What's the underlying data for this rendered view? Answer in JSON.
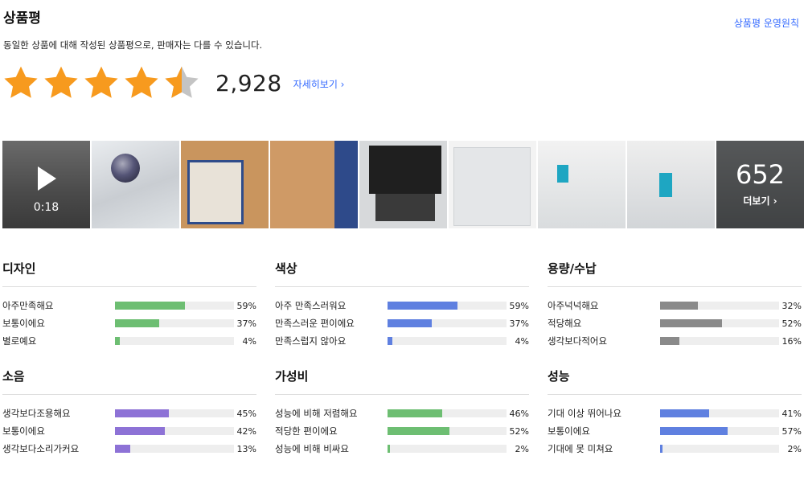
{
  "header": {
    "title": "상품평",
    "policy_link": "상품평 운영원칙",
    "subtitle": "동일한 상품에 대해 작성된 상품평으로, 판매자는 다를 수 있습니다."
  },
  "rating": {
    "stars": 4.5,
    "review_count": "2,928",
    "detail_link": "자세히보기 ›"
  },
  "gallery": {
    "video_duration": "0:18",
    "more_count": "652",
    "more_label": "더보기 ›",
    "thumbnails": [
      "video",
      "photo",
      "photo",
      "photo",
      "photo",
      "photo",
      "photo",
      "photo",
      "more"
    ]
  },
  "colors": {
    "star": "#f79a1e",
    "star_empty": "#c4c4c4",
    "green": "#6dbe72",
    "blue": "#5f80e0",
    "gray": "#8a8a8a",
    "purple": "#8d72d6",
    "link": "#346aff"
  },
  "surveys": [
    {
      "title": "디자인",
      "color": "#6dbe72",
      "rows": [
        {
          "label": "아주만족해요",
          "value": 59,
          "pct": "59%"
        },
        {
          "label": "보통이에요",
          "value": 37,
          "pct": "37%"
        },
        {
          "label": "별로예요",
          "value": 4,
          "pct": "4%"
        }
      ]
    },
    {
      "title": "색상",
      "color": "#5f80e0",
      "rows": [
        {
          "label": "아주 만족스러워요",
          "value": 59,
          "pct": "59%"
        },
        {
          "label": "만족스러운 편이에요",
          "value": 37,
          "pct": "37%"
        },
        {
          "label": "만족스럽지 않아요",
          "value": 4,
          "pct": "4%"
        }
      ]
    },
    {
      "title": "용량/수납",
      "color": "#8a8a8a",
      "rows": [
        {
          "label": "아주넉넉해요",
          "value": 32,
          "pct": "32%"
        },
        {
          "label": "적당해요",
          "value": 52,
          "pct": "52%"
        },
        {
          "label": "생각보다적어요",
          "value": 16,
          "pct": "16%"
        }
      ]
    },
    {
      "title": "소음",
      "color": "#8d72d6",
      "rows": [
        {
          "label": "생각보다조용해요",
          "value": 45,
          "pct": "45%"
        },
        {
          "label": "보통이에요",
          "value": 42,
          "pct": "42%"
        },
        {
          "label": "생각보다소리가커요",
          "value": 13,
          "pct": "13%"
        }
      ]
    },
    {
      "title": "가성비",
      "color": "#6dbe72",
      "rows": [
        {
          "label": "성능에 비해 저렴해요",
          "value": 46,
          "pct": "46%"
        },
        {
          "label": "적당한 편이에요",
          "value": 52,
          "pct": "52%"
        },
        {
          "label": "성능에 비해 비싸요",
          "value": 2,
          "pct": "2%"
        }
      ]
    },
    {
      "title": "성능",
      "color": "#5f80e0",
      "rows": [
        {
          "label": "기대 이상 뛰어나요",
          "value": 41,
          "pct": "41%"
        },
        {
          "label": "보통이에요",
          "value": 57,
          "pct": "57%"
        },
        {
          "label": "기대에 못 미쳐요",
          "value": 2,
          "pct": "2%"
        }
      ]
    }
  ]
}
